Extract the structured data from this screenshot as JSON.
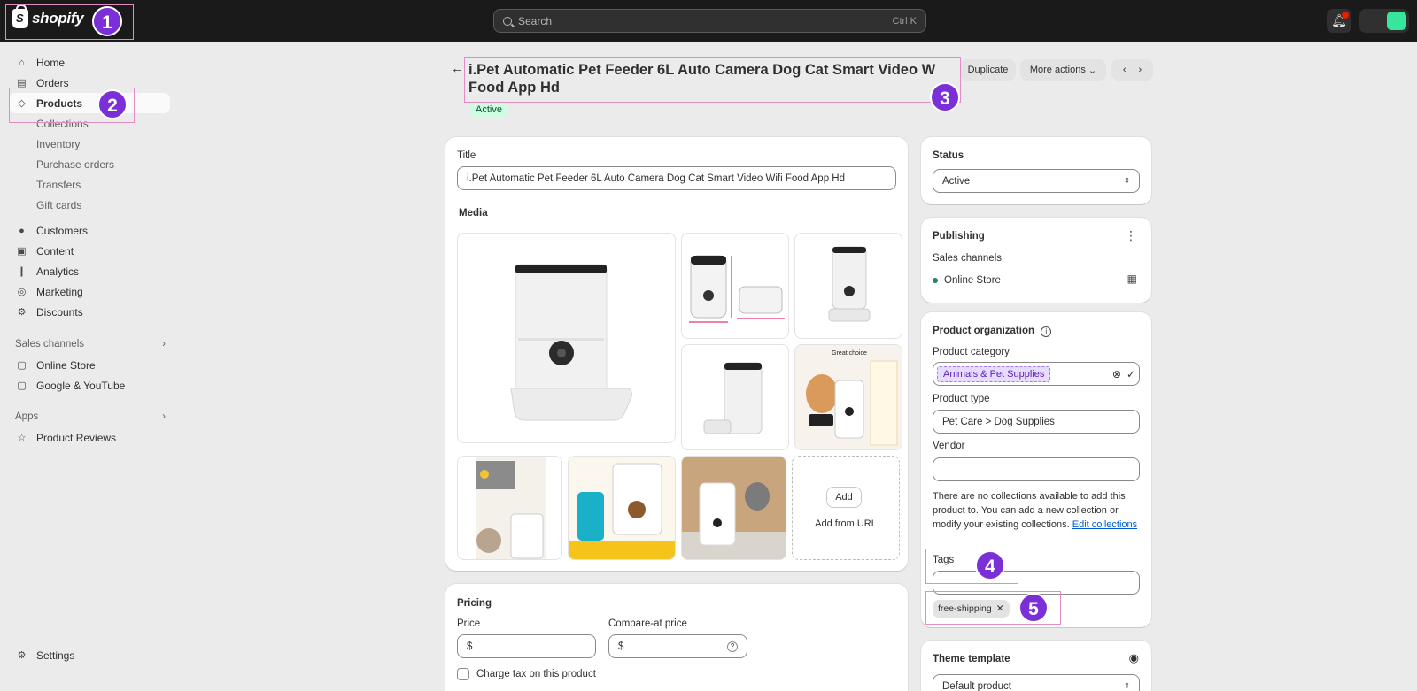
{
  "brand": {
    "name": "shopify"
  },
  "search": {
    "placeholder": "Search",
    "shortcut": "Ctrl K"
  },
  "notifications": {
    "count": "1"
  },
  "sidebar": {
    "items": [
      {
        "label": "Home",
        "icon": "home-icon"
      },
      {
        "label": "Orders",
        "icon": "inbox-icon"
      },
      {
        "label": "Products",
        "icon": "tag-icon"
      },
      {
        "label": "Collections"
      },
      {
        "label": "Inventory"
      },
      {
        "label": "Purchase orders"
      },
      {
        "label": "Transfers"
      },
      {
        "label": "Gift cards"
      },
      {
        "label": "Customers",
        "icon": "person-icon"
      },
      {
        "label": "Content",
        "icon": "content-icon"
      },
      {
        "label": "Analytics",
        "icon": "bar-chart-icon"
      },
      {
        "label": "Marketing",
        "icon": "target-icon"
      },
      {
        "label": "Discounts",
        "icon": "discount-icon"
      }
    ],
    "sales_channels_label": "Sales channels",
    "sales_channels": [
      {
        "label": "Online Store",
        "icon": "store-icon"
      },
      {
        "label": "Google & YouTube",
        "icon": "google-icon"
      }
    ],
    "apps_label": "Apps",
    "apps": [
      {
        "label": "Product Reviews",
        "icon": "star-icon"
      }
    ],
    "settings_label": "Settings"
  },
  "header": {
    "title_line1": "i.Pet Automatic Pet Feeder 6L Auto Camera Dog Cat Smart Video W",
    "title_line2": "Food App Hd",
    "status_badge": "Active",
    "duplicate": "Duplicate",
    "more_actions": "More actions"
  },
  "product": {
    "title_label": "Title",
    "title_value": "i.Pet Automatic Pet Feeder 6L Auto Camera Dog Cat Smart Video Wifi Food App Hd",
    "media_label": "Media",
    "add_button": "Add",
    "add_from_url": "Add from URL",
    "media_callout": "Great choice"
  },
  "pricing": {
    "heading": "Pricing",
    "price_label": "Price",
    "compare_label": "Compare-at price",
    "currency": "$",
    "charge_tax": "Charge tax on this product"
  },
  "status_card": {
    "heading": "Status",
    "value": "Active"
  },
  "publishing": {
    "heading": "Publishing",
    "sales_channels": "Sales channels",
    "channel": "Online Store"
  },
  "organization": {
    "heading": "Product organization",
    "category_label": "Product category",
    "category_value": "Animals & Pet Supplies",
    "type_label": "Product type",
    "type_value": "Pet Care > Dog Supplies",
    "vendor_label": "Vendor",
    "vendor_value": "",
    "collections_note": "There are no collections available to add this product to. You can add a new collection or modify your existing collections.",
    "edit_collections": "Edit collections",
    "tags_label": "Tags",
    "tags": [
      "free-shipping"
    ]
  },
  "theme": {
    "heading": "Theme template",
    "value": "Default product"
  },
  "annotations": [
    "1",
    "2",
    "3",
    "4",
    "5"
  ],
  "colors": {
    "topbar": "#1a1a1a",
    "accent": "#7b2fd6",
    "annotation_border": "#e48cc3",
    "active_badge": "#cdfee1",
    "category_chip": "#e7dcff"
  }
}
